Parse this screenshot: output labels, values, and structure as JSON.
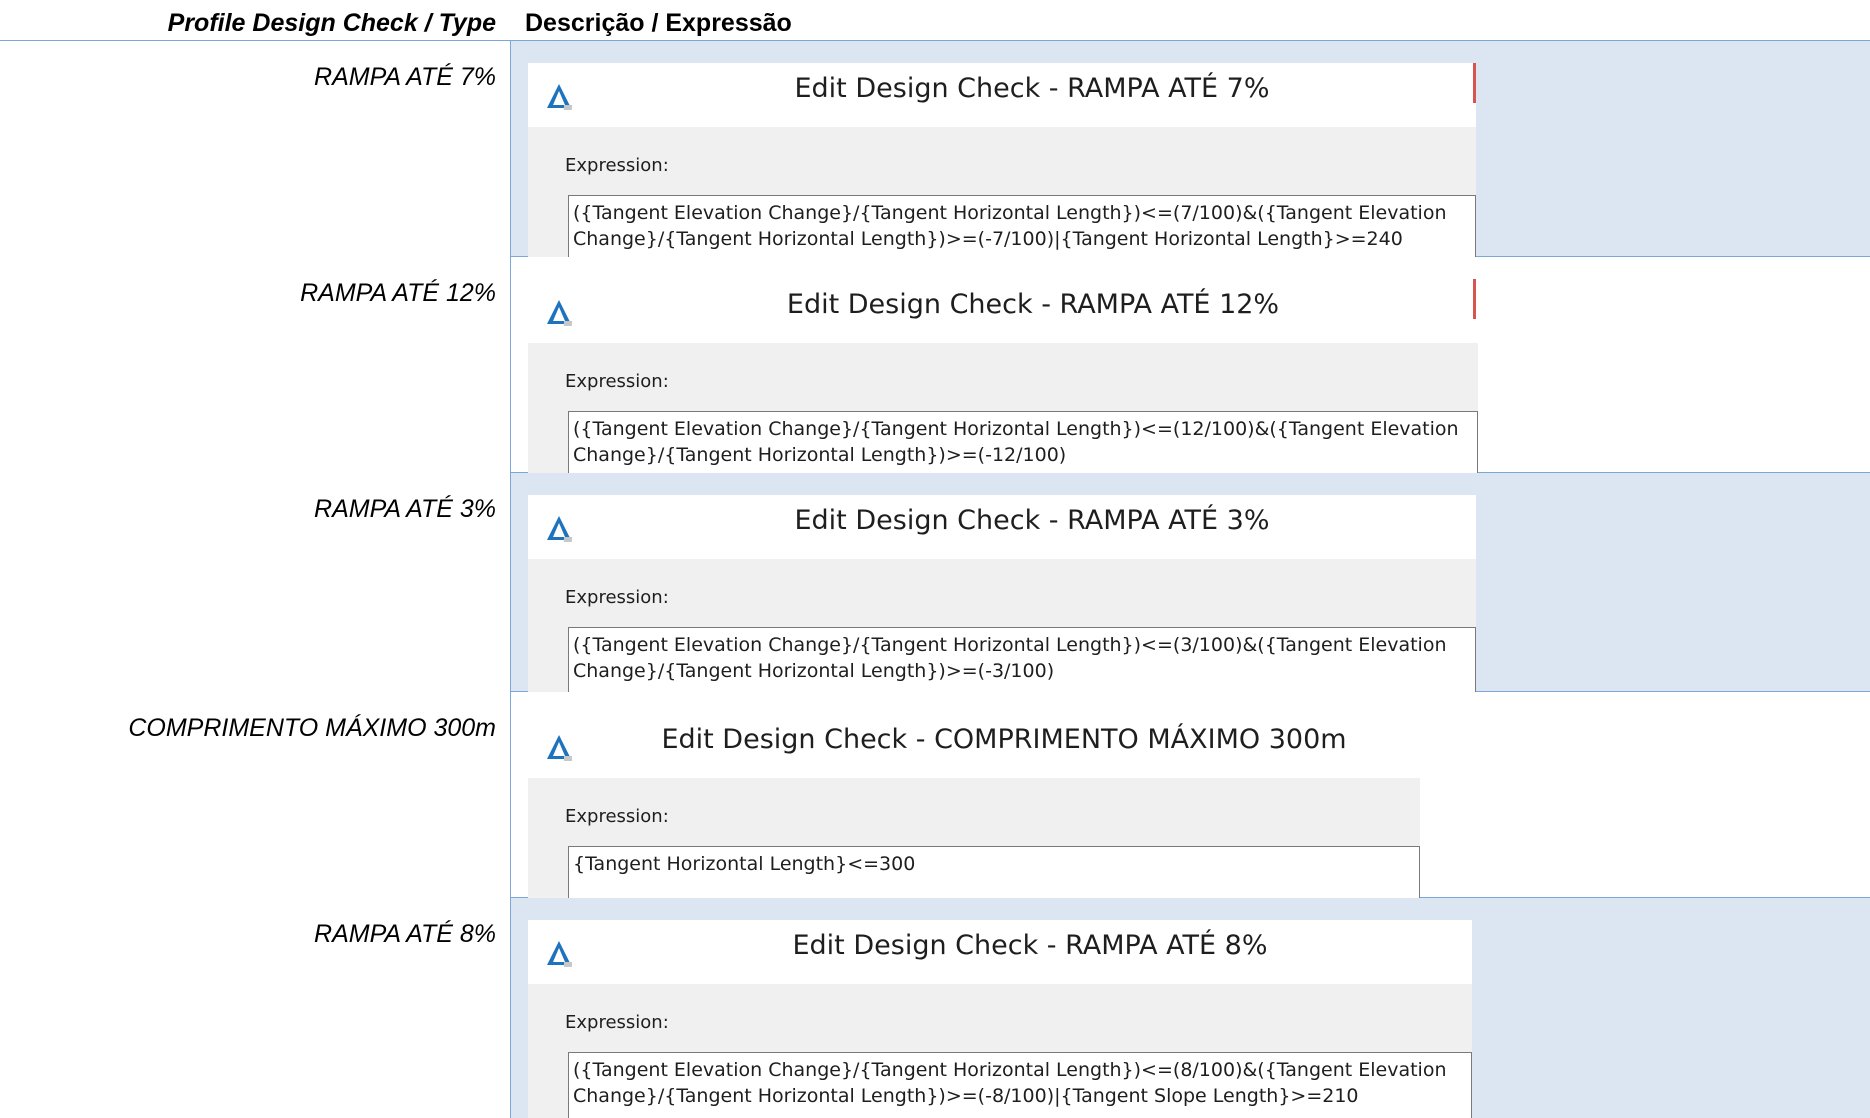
{
  "header": {
    "type_col": "Profile Design Check / Type",
    "desc_col": "Descrição / Expressão"
  },
  "rows": [
    {
      "type": "RAMPA ATÉ 7%",
      "dialog_title": "Edit Design Check - RAMPA ATÉ 7%",
      "expression_label": "Expression:",
      "expression": "({Tangent Elevation Change}/{Tangent Horizontal Length})<=(7/100)&({Tangent Elevation Change}/{Tangent Horizontal Length})>=(-7/100)|{Tangent Horizontal Length}>=240"
    },
    {
      "type": "RAMPA ATÉ 12%",
      "dialog_title": "Edit Design Check - RAMPA ATÉ 12%",
      "expression_label": "Expression:",
      "expression": "({Tangent Elevation Change}/{Tangent Horizontal Length})<=(12/100)&({Tangent Elevation Change}/{Tangent Horizontal Length})>=(-12/100)"
    },
    {
      "type": "RAMPA ATÉ 3%",
      "dialog_title": "Edit Design Check - RAMPA ATÉ 3%",
      "expression_label": "Expression:",
      "expression": "({Tangent Elevation Change}/{Tangent Horizontal Length})<=(3/100)&({Tangent Elevation Change}/{Tangent Horizontal Length})>=(-3/100)"
    },
    {
      "type": "COMPRIMENTO MÁXIMO 300m",
      "dialog_title": "Edit Design Check - COMPRIMENTO MÁXIMO 300m",
      "expression_label": "Expression:",
      "expression": "{Tangent Horizontal Length}<=300"
    },
    {
      "type": "RAMPA ATÉ 8%",
      "dialog_title": "Edit Design Check - RAMPA ATÉ 8%",
      "expression_label": "Expression:",
      "expression": "({Tangent Elevation Change}/{Tangent Horizontal Length})<=(8/100)&({Tangent Elevation Change}/{Tangent Horizontal Length})>=(-8/100)|{Tangent Slope Length}>=210"
    }
  ],
  "colors": {
    "row_shade": "#dce6f2",
    "grid_line": "#7da7d9",
    "dialog_bg": "#f0f0f0"
  },
  "icons": [
    "civil3d-app-icon"
  ]
}
